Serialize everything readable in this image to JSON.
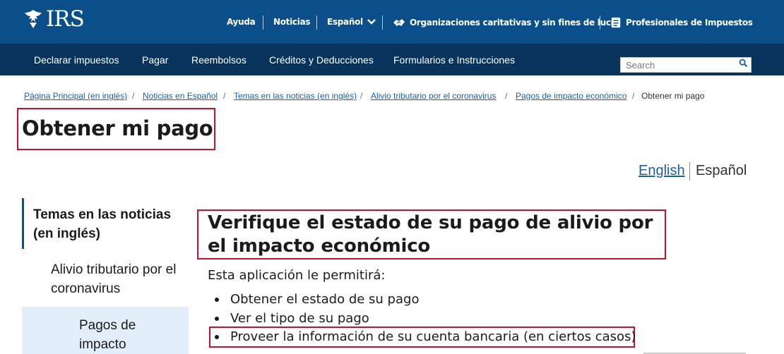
{
  "header": {
    "logo_text": "IRS",
    "nav": {
      "ayuda": "Ayuda",
      "noticias": "Noticias",
      "espanol": "Español",
      "organizaciones": "Organizaciones caritativas y sin fines de lucro",
      "profesionales": "Profesionales de Impuestos"
    },
    "bg_color": "#0b4f8a"
  },
  "main_nav": {
    "items": [
      "Declarar impuestos",
      "Pagar",
      "Reembolsos",
      "Créditos y Deducciones",
      "Formularios e Instrucciones"
    ],
    "search_placeholder": "Search",
    "bg_color": "#08335a"
  },
  "breadcrumb": {
    "links": [
      "Página Principal (en inglés)",
      "Noticias en Español",
      "Temas en las noticias (en inglés)",
      "Alivio tributario por el coronavirus",
      "Pagos de impacto económico"
    ],
    "current": "Obtener mi pago"
  },
  "page_title": "Obtener mi pago",
  "language": {
    "english": "English",
    "spanish": "Español"
  },
  "sidebar": {
    "heading": "Temas en las noticias (en inglés)",
    "item": "Alivio tributario por el coronavirus",
    "active_item": "Pagos de impacto"
  },
  "content": {
    "heading": "Verifique el estado de su pago de alivio por el impacto económico",
    "intro": "Esta aplicación le permitirá:",
    "list": [
      "Obtener el estado de su pago",
      "Ver el tipo de su pago",
      "Proveer la información de su cuenta bancaria (en ciertos casos)"
    ]
  },
  "colors": {
    "highlight": "#c8102e",
    "link": "#1f5ca6"
  }
}
